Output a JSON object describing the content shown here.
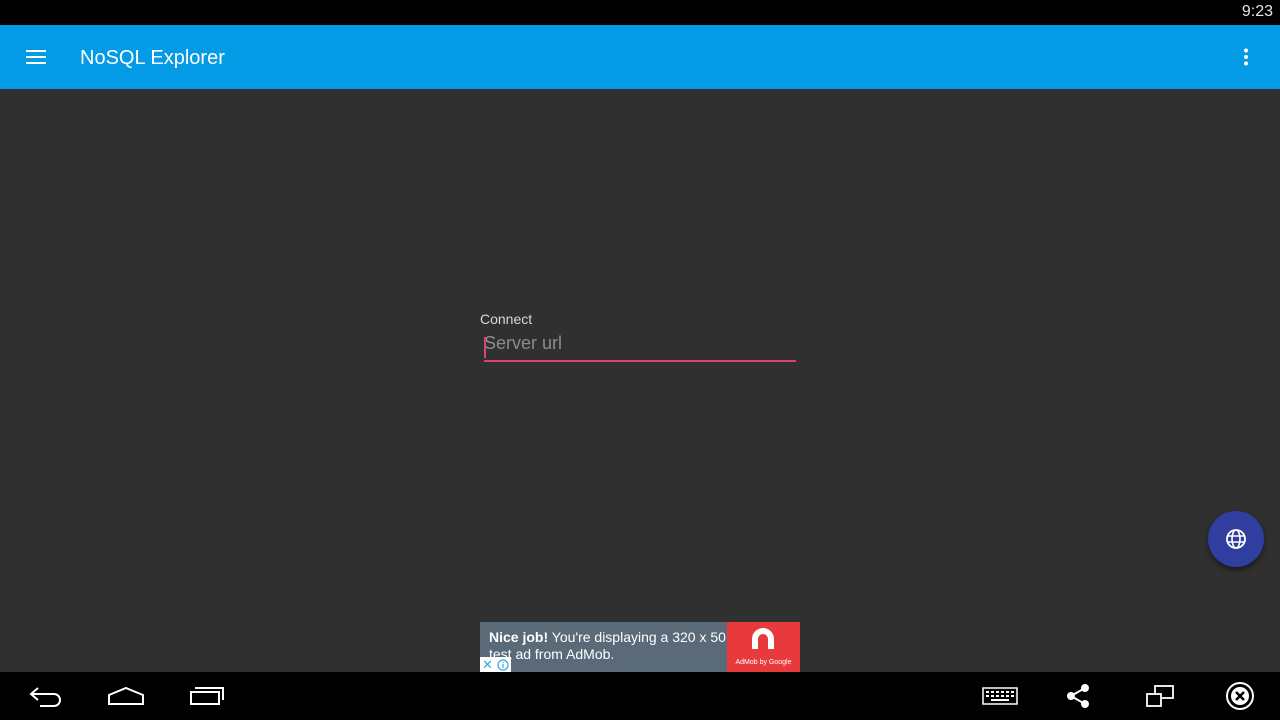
{
  "status_bar": {
    "time": "9:23"
  },
  "app_bar": {
    "title": "NoSQL Explorer",
    "menu_icon": "hamburger-menu-icon",
    "overflow_icon": "more-vert-icon",
    "color": "#039be5"
  },
  "connect": {
    "label": "Connect",
    "input_value": "",
    "input_placeholder": "Server url",
    "accent_color": "#e0407a"
  },
  "ad": {
    "headline": "Nice job!",
    "body": "You're displaying a 320 x 50 test ad from AdMob.",
    "logo_caption": "AdMob by Google",
    "close_glyph": "✕"
  },
  "fab": {
    "icon": "globe-icon",
    "color": "#303f9f"
  },
  "nav_bar": {
    "buttons": [
      "back-icon",
      "home-icon",
      "recent-apps-icon",
      "keyboard-icon",
      "share-icon",
      "screen-rotate-icon",
      "close-circle-icon"
    ]
  }
}
